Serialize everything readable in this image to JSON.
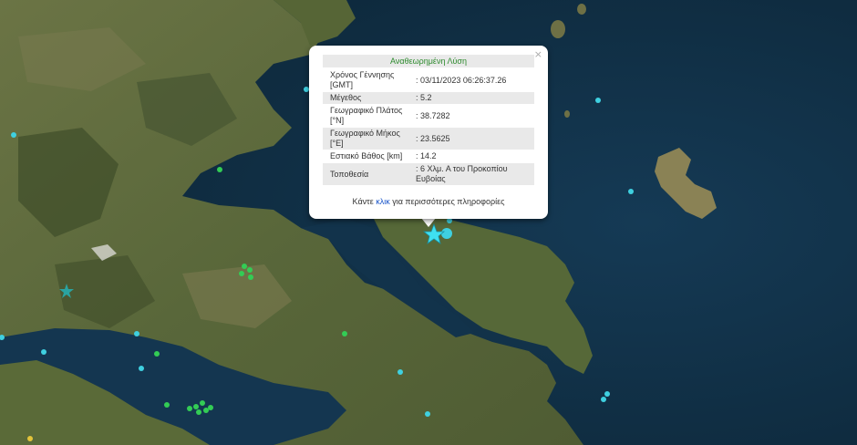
{
  "popup": {
    "title": "Αναθεωρημένη Λύση",
    "close": "×",
    "rows": [
      {
        "label": "Χρόνος Γέννησης [GMT]",
        "value": ": 03/11/2023 06:26:37.26"
      },
      {
        "label": "Μέγεθος",
        "value": ": 5.2"
      },
      {
        "label": "Γεωγραφικό Πλάτος [°N]",
        "value": ": 38.7282"
      },
      {
        "label": "Γεωγραφικό Μήκος [°E]",
        "value": ": 23.5625"
      },
      {
        "label": "Εστιακό Βάθος [km]",
        "value": ": 14.2"
      },
      {
        "label": "Τοποθεσία",
        "value": ": 6 Χλμ. Α του Προκοπίου Ευβοίας"
      }
    ],
    "more_prefix": "Κάντε ",
    "more_link": "κλικ",
    "more_suffix": " για περισσότερες πληροφορίες"
  },
  "colors": {
    "sea": "#0f2a3d",
    "land": "#5d6d3a",
    "marker": "#3fd0e0",
    "green_marker": "#33cc55"
  },
  "icons": {
    "epicenter": "star-icon"
  }
}
